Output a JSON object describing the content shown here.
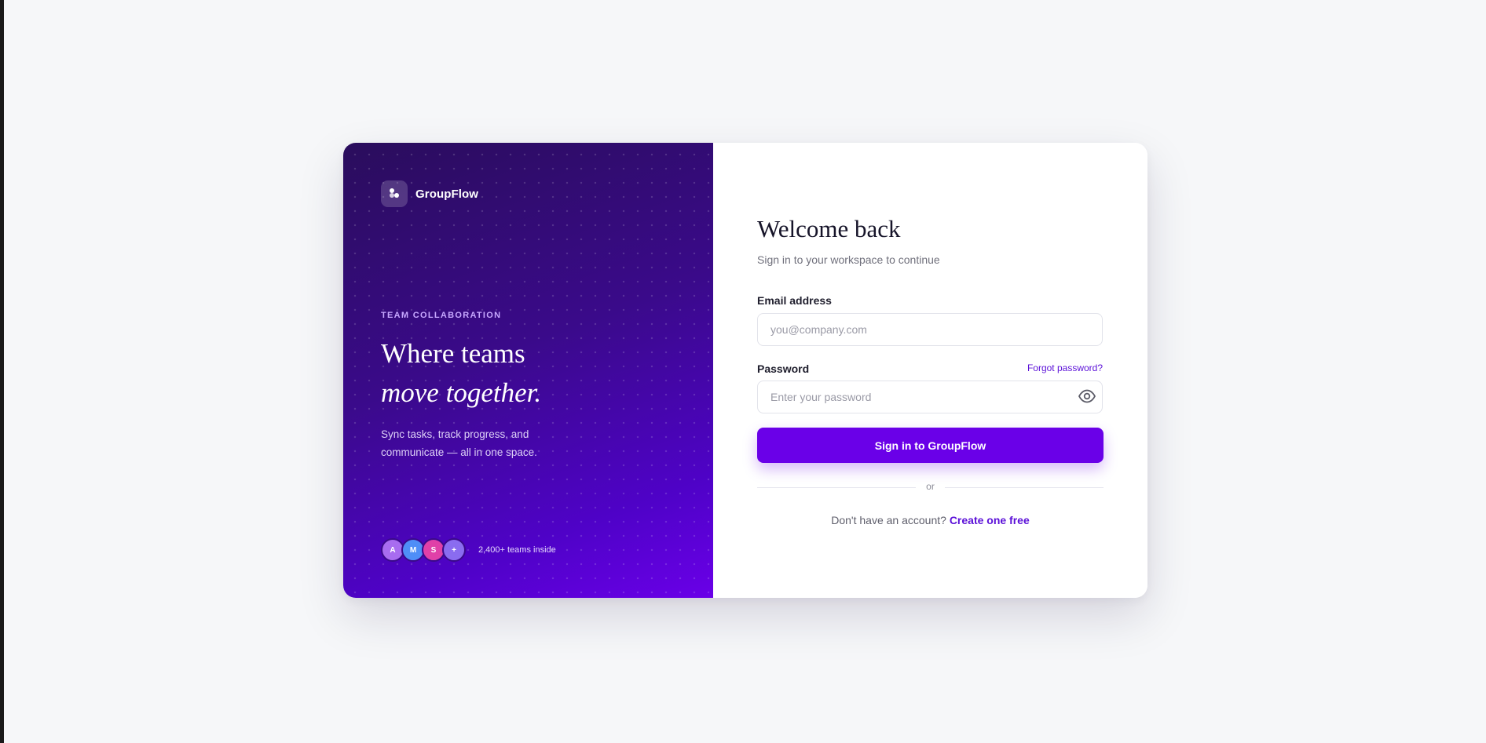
{
  "brand": {
    "name": "GroupFlow",
    "logo_icon": "groupflow-logo-icon"
  },
  "hero": {
    "eyebrow": "TEAM COLLABORATION",
    "headline_line1": "Where teams",
    "headline_line2": "move together.",
    "lead": "Sync tasks, track progress, and communicate — all in one space."
  },
  "social_proof": {
    "avatars": [
      {
        "initial": "A",
        "color": "#a86cf0"
      },
      {
        "initial": "M",
        "color": "#4f8ef7"
      },
      {
        "initial": "S",
        "color": "#e040a8"
      },
      {
        "initial": "+",
        "color": "#8a6cf0"
      }
    ],
    "text": "2,400+ teams inside"
  },
  "form": {
    "title": "Welcome back",
    "subtitle": "Sign in to your workspace to continue",
    "email_label": "Email address",
    "email_placeholder": "you@company.com",
    "email_value": "",
    "password_label": "Password",
    "forgot_label": "Forgot password?",
    "password_placeholder": "Enter your password",
    "password_value": "",
    "toggle_icon": "eye-icon",
    "submit_label": "Sign in to GroupFlow",
    "divider_text": "or",
    "signup_prompt": "Don't have an account?",
    "signup_link": "Create one free"
  },
  "colors": {
    "accent": "#6a00e8",
    "link": "#5b10d8",
    "panel_dark": "#2a0d5c",
    "page_bg": "#f6f7f9"
  }
}
